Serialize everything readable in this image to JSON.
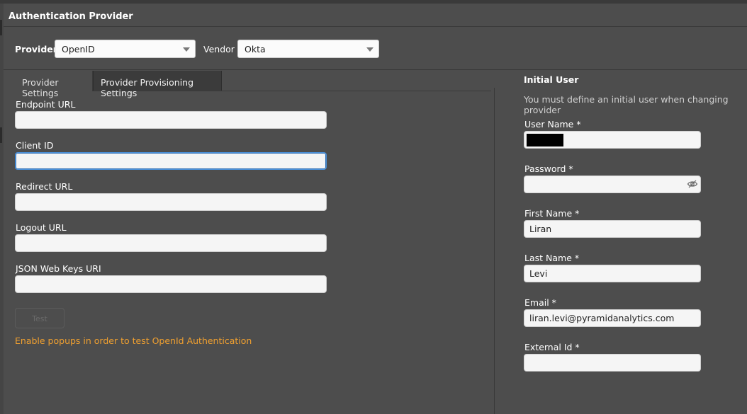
{
  "header": {
    "title": "Authentication Provider"
  },
  "provider": {
    "label": "Provider",
    "value": "OpenID"
  },
  "vendor": {
    "label": "Vendor",
    "value": "Okta"
  },
  "tabs": [
    {
      "label": "Provider Settings",
      "active": true
    },
    {
      "label": "Provider Provisioning Settings",
      "active": false
    }
  ],
  "settings": {
    "endpoint_url": {
      "label": "Endpoint URL",
      "value": ""
    },
    "client_id": {
      "label": "Client ID",
      "value": ""
    },
    "redirect_url": {
      "label": "Redirect URL",
      "value": ""
    },
    "logout_url": {
      "label": "Logout URL",
      "value": ""
    },
    "jwks_uri": {
      "label": "JSON Web Keys URI",
      "value": ""
    },
    "test_button": "Test",
    "warning": "Enable popups in order to test OpenId Authentication"
  },
  "initial_user": {
    "title": "Initial User",
    "subtitle": "You must define an initial user when changing provider",
    "username": {
      "label": "User Name *",
      "value": ""
    },
    "password": {
      "label": "Password *",
      "value": ""
    },
    "first_name": {
      "label": "First Name *",
      "value": "Liran"
    },
    "last_name": {
      "label": "Last Name *",
      "value": "Levi"
    },
    "email": {
      "label": "Email *",
      "value": "liran.levi@pyramidanalytics.com"
    },
    "external_id": {
      "label": "External Id *",
      "value": ""
    }
  },
  "colors": {
    "background": "#4d4d4d",
    "warning": "#f0a030",
    "focus": "#4a90d9"
  },
  "icons": {
    "password_toggle": "eye-slash-icon",
    "dropdown": "chevron-down-icon"
  }
}
